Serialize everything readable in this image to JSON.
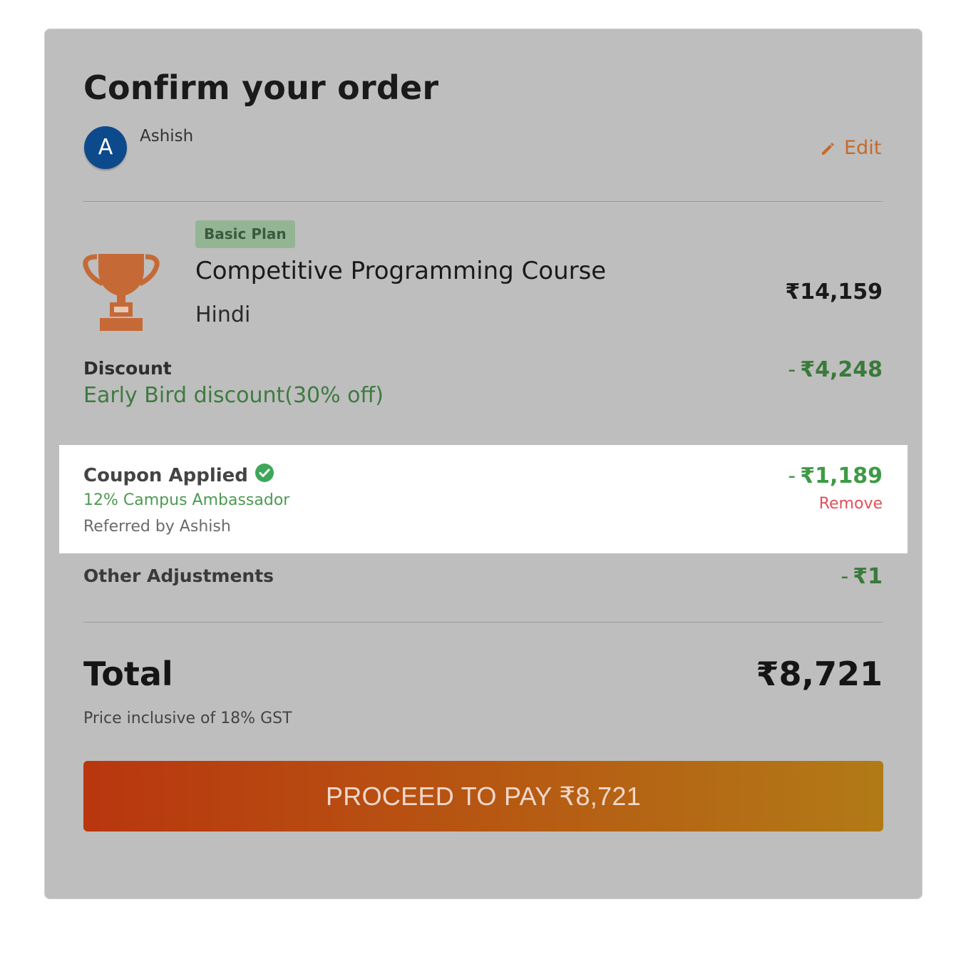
{
  "header": {
    "title": "Confirm your order",
    "user": {
      "avatar_initial": "A",
      "name": "Ashish"
    },
    "edit_label": "Edit",
    "edit_icon": "pencil-icon"
  },
  "course": {
    "plan_badge": "Basic Plan",
    "name": "Competitive Programming Course",
    "language": "Hindi",
    "price": "₹14,159",
    "icon": "trophy-icon"
  },
  "discount": {
    "label": "Discount",
    "description": "Early Bird discount(30% off)",
    "sign": "-",
    "amount": "₹4,248"
  },
  "coupon": {
    "label": "Coupon Applied",
    "status_icon": "check-circle-icon",
    "code": "12% Campus Ambassador",
    "referred_by": "Referred by Ashish",
    "sign": "-",
    "amount": "₹1,189",
    "remove_label": "Remove"
  },
  "other_adjustments": {
    "label": "Other Adjustments",
    "sign": "-",
    "amount": "₹1"
  },
  "total": {
    "label": "Total",
    "amount": "₹8,721",
    "note": "Price inclusive of 18% GST"
  },
  "pay_button": {
    "label": "PROCEED TO PAY ₹8,721"
  },
  "colors": {
    "brand_orange": "#c46a2c",
    "discount_green": "#3a7a3b",
    "coupon_green": "#4c9a52",
    "remove_red": "#e0505a",
    "avatar_blue": "#0d4a8c",
    "badge_green": "#93b594"
  }
}
